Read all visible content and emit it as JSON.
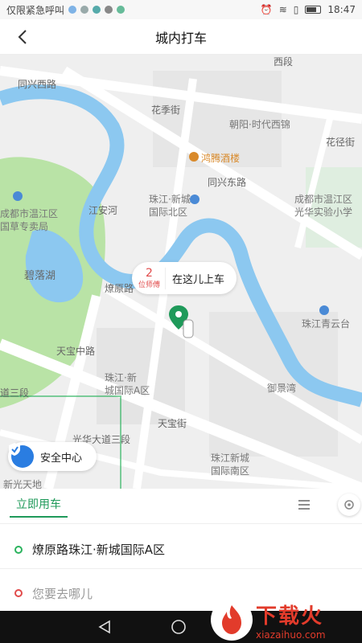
{
  "statusbar": {
    "left_text": "仅限紧急呼叫",
    "time": "18:47"
  },
  "header": {
    "title": "城内打车"
  },
  "map": {
    "labels": {
      "tongxing_west": "同兴西路",
      "xi_duan": "西段",
      "huaxiang": "花季街",
      "chaoyang": "朝阳·时代西锦",
      "huajie_right": "花径街",
      "hongteng": "鸿腾酒楼",
      "zhujiang_north": "珠江·新城\n国际北区",
      "tongxing_east": "同兴东路",
      "wenjiang_school": "成都市温江区\n光华实验小学",
      "wenjiang_bureau": "成都市温江区\n国草专卖局",
      "jiangan": "江安河",
      "biluo": "碧落湖",
      "liaoyuan": "燎原路",
      "zhujiang_qingyun": "珠江青云台",
      "tianbao_center": "天宝中路",
      "zhujiang_a": "珠江·新\n城国际A区",
      "yujing": "御景湾",
      "dao_sanduan": "道三段",
      "guanghua": "光华大道三段",
      "tianbao_jie": "天宝街",
      "zhujiang_south": "珠江新城\n国际南区",
      "xinguang": "新光天地"
    },
    "pin_callout": {
      "count": "2",
      "unit": "位师傅",
      "text": "在这儿上车"
    },
    "safety_center": "安全中心"
  },
  "tabs": {
    "now": "立即用车"
  },
  "form": {
    "origin": "燎原路珠江·新城国际A区",
    "destination_placeholder": "您要去哪儿"
  },
  "watermark": {
    "brand": "下载火",
    "domain": "xiazaihuo.com"
  },
  "colors": {
    "accent_green": "#1f9a5a",
    "origin_dot": "#2bb35e",
    "dest_dot": "#e14b4b",
    "river": "#8cc8f0",
    "park": "#b9e3a6",
    "safety_blue": "#2a7de1"
  }
}
